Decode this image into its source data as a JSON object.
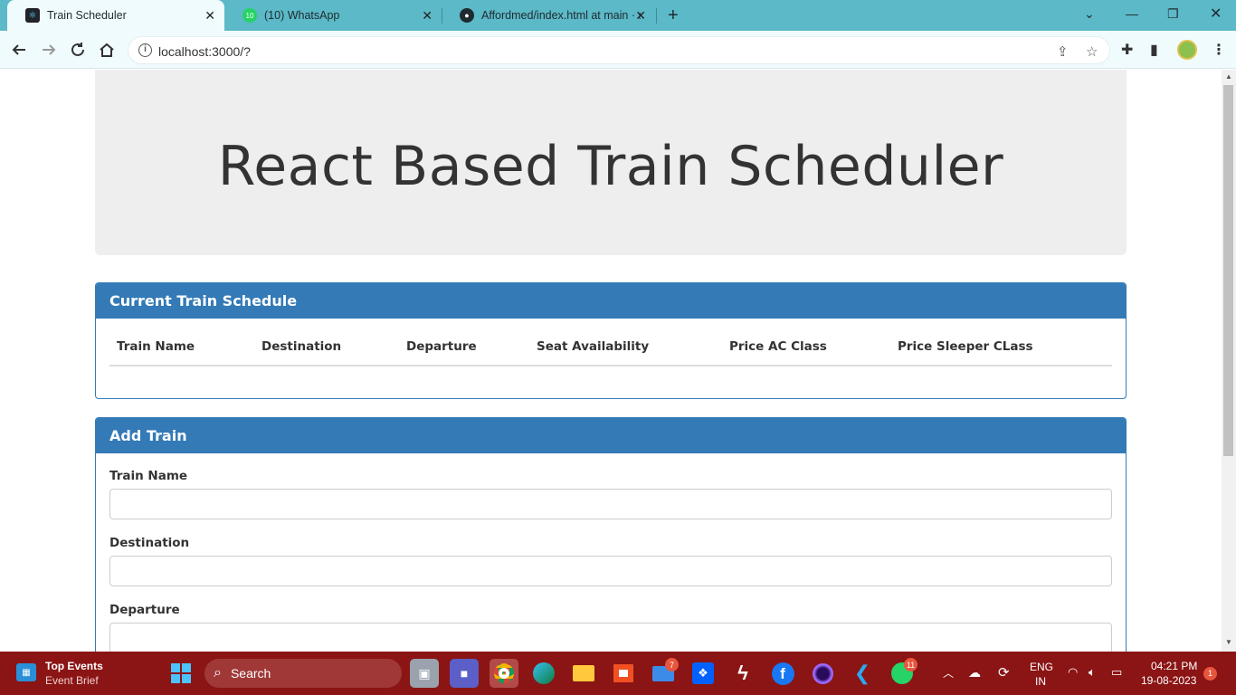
{
  "browser": {
    "tabs": [
      {
        "title": "Train Scheduler",
        "active": true
      },
      {
        "title": "(10) WhatsApp",
        "active": false
      },
      {
        "title": "Affordmed/index.html at main · s",
        "active": false
      }
    ],
    "new_tab_label": "+",
    "address": "localhost:3000/?"
  },
  "page": {
    "heading": "React Based Train Scheduler",
    "schedule": {
      "title": "Current Train Schedule",
      "columns": [
        "Train Name",
        "Destination",
        "Departure",
        "Seat Availability",
        "Price AC Class",
        "Price Sleeper CLass"
      ]
    },
    "add_train": {
      "title": "Add Train",
      "fields": [
        {
          "label": "Train Name",
          "value": ""
        },
        {
          "label": "Destination",
          "value": ""
        },
        {
          "label": "Departure",
          "value": ""
        }
      ]
    }
  },
  "taskbar": {
    "widget_title": "Top Events",
    "widget_sub": "Event Brief",
    "search_label": "Search",
    "mail_badge": "7",
    "whatsapp_badge": "11",
    "lang_top": "ENG",
    "lang_bottom": "IN",
    "time": "04:21 PM",
    "date": "19-08-2023",
    "notif_count": "1"
  },
  "colors": {
    "tabbar": "#5cb9c7",
    "panel_header": "#337ab7",
    "jumbotron": "#eeeeee",
    "taskbar": "#8b1414"
  }
}
